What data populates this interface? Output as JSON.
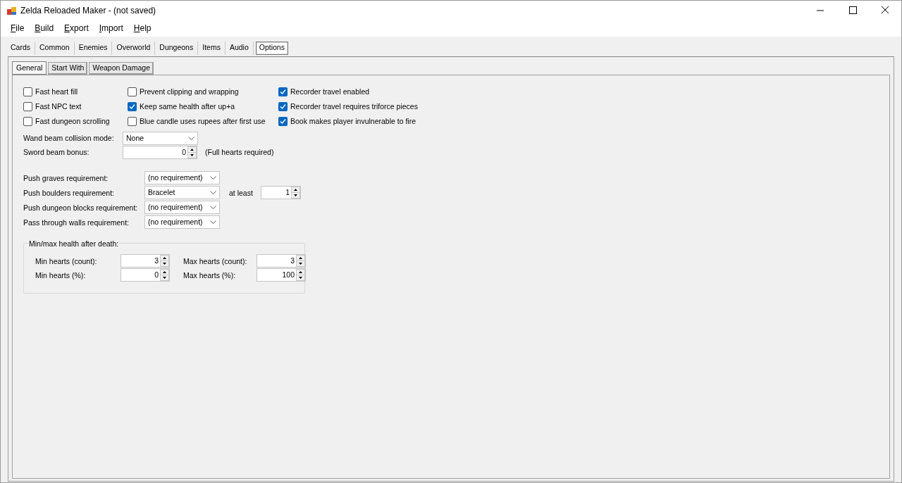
{
  "window": {
    "title": "Zelda Reloaded Maker - (not saved)"
  },
  "menu": [
    {
      "label": "File"
    },
    {
      "label": "Build"
    },
    {
      "label": "Export"
    },
    {
      "label": "Import"
    },
    {
      "label": "Help"
    }
  ],
  "tabs": [
    {
      "label": "Cards",
      "selected": false
    },
    {
      "label": "Common",
      "selected": false
    },
    {
      "label": "Enemies",
      "selected": false
    },
    {
      "label": "Overworld",
      "selected": false
    },
    {
      "label": "Dungeons",
      "selected": false
    },
    {
      "label": "Items",
      "selected": false
    },
    {
      "label": "Audio",
      "selected": false
    },
    {
      "label": "Options",
      "selected": true
    }
  ],
  "subtabs": [
    {
      "label": "General",
      "selected": true
    },
    {
      "label": "Start With",
      "selected": false
    },
    {
      "label": "Weapon Damage",
      "selected": false
    }
  ],
  "checkbox_columns": [
    [
      {
        "label": "Fast heart fill",
        "checked": false
      },
      {
        "label": "Fast NPC text",
        "checked": false
      },
      {
        "label": "Fast dungeon scrolling",
        "checked": false
      }
    ],
    [
      {
        "label": "Prevent clipping and wrapping",
        "checked": false
      },
      {
        "label": "Keep same health after up+a",
        "checked": true
      },
      {
        "label": "Blue candle uses rupees after first use",
        "checked": false
      }
    ],
    [
      {
        "label": "Recorder travel enabled",
        "checked": true
      },
      {
        "label": "Recorder travel requires triforce pieces",
        "checked": true
      },
      {
        "label": "Book makes player invulnerable to fire",
        "checked": true
      }
    ]
  ],
  "wand_beam": {
    "label": "Wand beam collision mode:",
    "value": "None"
  },
  "sword_beam": {
    "label": "Sword beam bonus:",
    "value": "0",
    "note": "(Full hearts required)"
  },
  "requirements": [
    {
      "label": "Push graves requirement:",
      "value": "(no requirement)"
    },
    {
      "label": "Push boulders requirement:",
      "value": "Bracelet",
      "extra_label": "at least",
      "extra_value": "1"
    },
    {
      "label": "Push dungeon blocks requirement:",
      "value": "(no requirement)"
    },
    {
      "label": "Pass through walls requirement:",
      "value": "(no requirement)"
    }
  ],
  "health_group": {
    "title": "Min/max health after death:",
    "fields": [
      {
        "label": "Min hearts (count):",
        "value": "3"
      },
      {
        "label": "Max hearts (count):",
        "value": "3"
      },
      {
        "label": "Min hearts (%):",
        "value": "0"
      },
      {
        "label": "Max hearts (%):",
        "value": "100"
      }
    ]
  }
}
